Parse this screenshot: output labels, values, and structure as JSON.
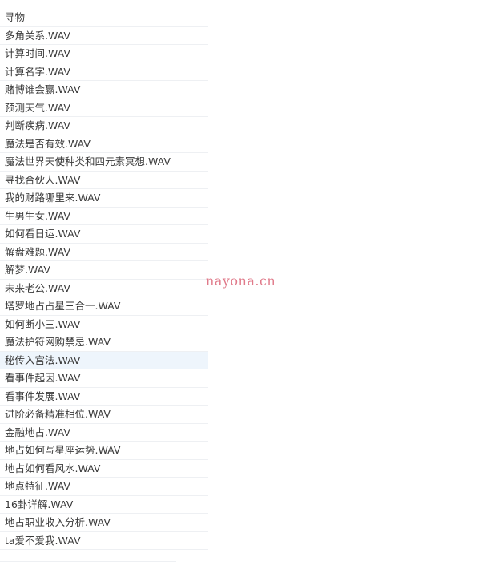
{
  "files": [
    "寻物",
    "多角关系.WAV",
    "计算时间.WAV",
    "计算名字.WAV",
    "赌博谁会赢.WAV",
    "预测天气.WAV",
    "判断疾病.WAV",
    "魔法是否有效.WAV",
    "魔法世界天使种类和四元素冥想.WAV",
    "寻找合伙人.WAV",
    "我的财路哪里来.WAV",
    "生男生女.WAV",
    "如何看日运.WAV",
    "解盘难题.WAV",
    "解梦.WAV",
    "未来老公.WAV",
    "塔罗地占占星三合一.WAV",
    "如何断小三.WAV",
    "魔法护符网购禁忌.WAV",
    "秘传入宫法.WAV",
    "看事件起因.WAV",
    "看事件发展.WAV",
    "进阶必备精准相位.WAV",
    "金融地占.WAV",
    "地占如何写星座运势.WAV",
    "地占如何看风水.WAV",
    "地点特征.WAV",
    "16卦详解.WAV",
    "地占职业收入分析.WAV",
    "ta爱不爱我.WAV"
  ],
  "selected": "秘传入宫法.WAV",
  "watermark": "nayona.cn",
  "colors": {
    "selected_bg": "#eef5fc",
    "watermark": "#e07a8a"
  }
}
